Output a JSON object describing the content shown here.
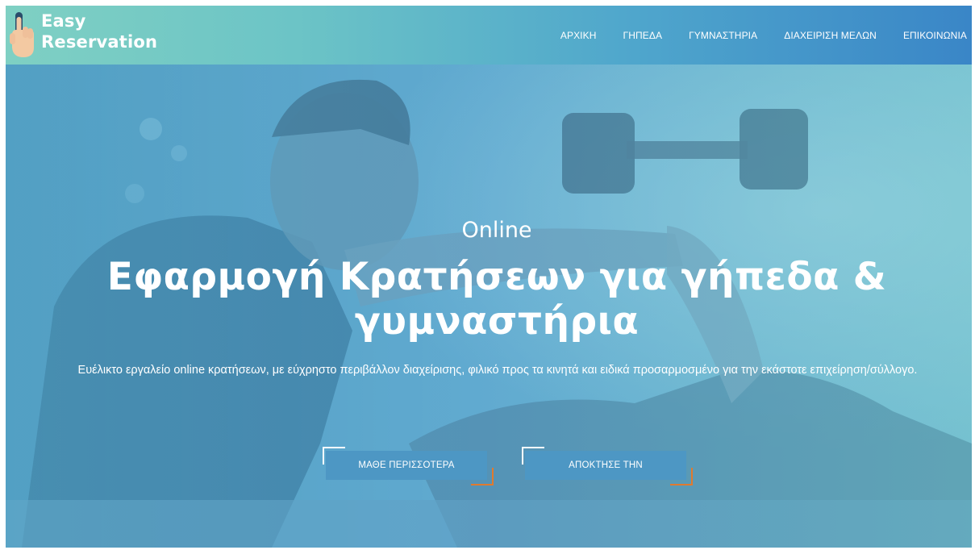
{
  "brand": {
    "line1": "Easy",
    "line2": "Reservation",
    "icon": "pointing-hand-icon"
  },
  "nav": {
    "items": [
      {
        "label": "ΑΡΧΙΚΗ"
      },
      {
        "label": "ΓΗΠΕΔΑ"
      },
      {
        "label": "ΓΥΜΝΑΣΤΗΡΙΑ"
      },
      {
        "label": "ΔΙΑΧΕΙΡΙΣΗ ΜΕΛΩΝ"
      },
      {
        "label": "ΕΠΙΚΟΙΝΩΝΙΑ"
      }
    ]
  },
  "hero": {
    "kicker": "Online",
    "title_line1": "Εφαρμογή Κρατήσεων για γήπεδα &",
    "title_line2": "γυμναστήρια",
    "description": "Ευέλικτο εργαλείο online κρατήσεων, με εύχρηστο περιβάλλον διαχείρισης, φιλικό προς τα κινητά και ειδικά προσαρμοσμένο για την εκάστοτε επιχείρηση/σύλλογο.",
    "buttons": [
      {
        "label": "ΜΑΘΕ ΠΕΡΙΣΣΟΤΕΡΑ"
      },
      {
        "label": "ΑΠΟΚΤΗΣΕ ΤΗΝ"
      }
    ]
  },
  "colors": {
    "header_start": "#7fd0c3",
    "header_end": "#3a86c7",
    "button_bg": "#4d97c4",
    "accent_orange": "#e07a2e"
  }
}
